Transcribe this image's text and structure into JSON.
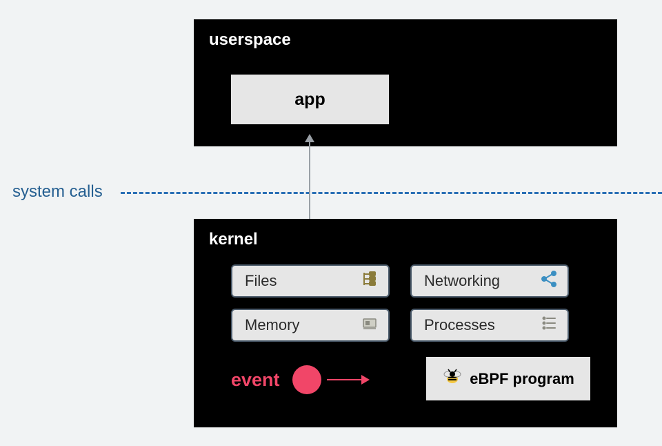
{
  "userspace": {
    "title": "userspace",
    "app_label": "app"
  },
  "boundary": {
    "label": "system calls"
  },
  "kernel": {
    "title": "kernel",
    "subsystems": {
      "files": "Files",
      "networking": "Networking",
      "memory": "Memory",
      "processes": "Processes"
    },
    "event_label": "event",
    "ebpf_label": "eBPF program"
  }
}
